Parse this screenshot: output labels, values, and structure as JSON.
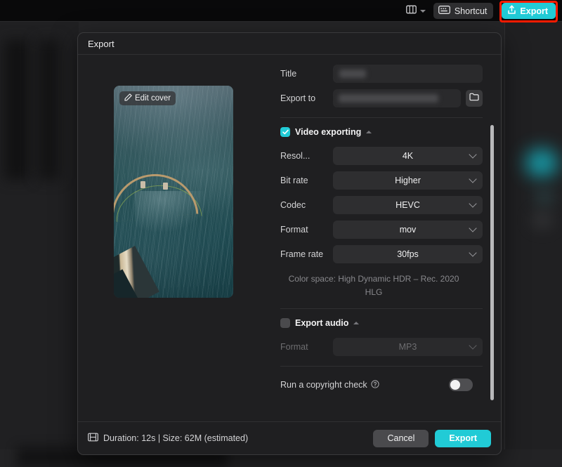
{
  "toolbar": {
    "layout_icon": "panel-layout-icon",
    "layout_caret_icon": "chevron-down-icon",
    "shortcut_icon": "keyboard-icon",
    "shortcut_label": "Shortcut",
    "export_icon": "upload-share-icon",
    "export_label": "Export",
    "highlight_color": "#ff1b00",
    "accent_color": "#21cbd6"
  },
  "dialog": {
    "title": "Export",
    "cover": {
      "edit_icon": "pencil-icon",
      "edit_label": "Edit cover"
    },
    "fields": {
      "title_label": "Title",
      "title_value": "",
      "export_to_label": "Export to",
      "export_to_value": "",
      "folder_icon": "folder-icon"
    },
    "video_section": {
      "checkbox_icon": "checkbox-checked-icon",
      "checked": true,
      "title": "Video exporting",
      "collapse_icon": "caret-up-icon",
      "rows": [
        {
          "label": "Resol...",
          "value": "4K"
        },
        {
          "label": "Bit rate",
          "value": "Higher"
        },
        {
          "label": "Codec",
          "value": "HEVC"
        },
        {
          "label": "Format",
          "value": "mov"
        },
        {
          "label": "Frame rate",
          "value": "30fps"
        }
      ],
      "color_space": "Color space: High Dynamic HDR – Rec. 2020 HLG"
    },
    "audio_section": {
      "checkbox_icon": "checkbox-unchecked-icon",
      "checked": false,
      "title": "Export audio",
      "collapse_icon": "caret-up-icon",
      "rows": [
        {
          "label": "Format",
          "value": "MP3"
        }
      ]
    },
    "copyright": {
      "label": "Run a copyright check",
      "info_icon": "question-circle-icon",
      "toggle_on": false
    },
    "footer": {
      "meta_icon": "film-strip-icon",
      "meta_text": "Duration: 12s | Size: 62M (estimated)",
      "cancel_label": "Cancel",
      "export_label": "Export"
    }
  }
}
